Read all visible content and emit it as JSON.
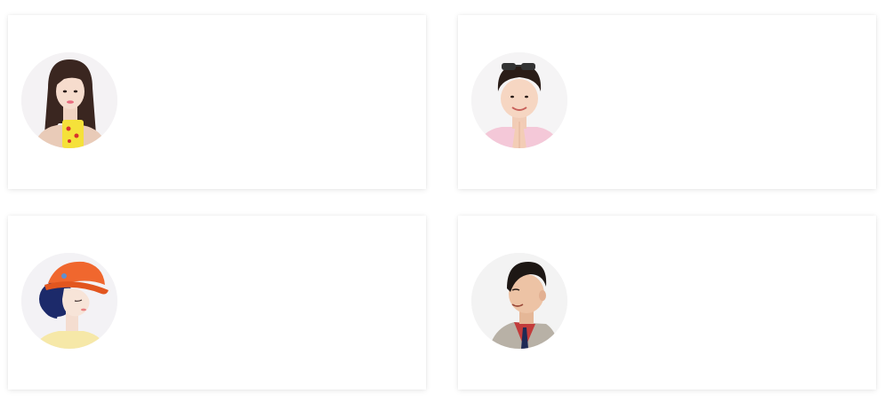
{
  "cards": [
    {
      "name": "",
      "description": ""
    },
    {
      "name": "",
      "description": ""
    },
    {
      "name": "",
      "description": ""
    },
    {
      "name": "",
      "description": ""
    }
  ],
  "colors": {
    "card_bg": "#ffffff",
    "avatar_bg": "#f3f2f4",
    "shadow": "rgba(0,0,0,0.10)"
  },
  "icons": [
    "avatar-woman-with-phone",
    "avatar-woman-with-glasses",
    "avatar-woman-with-orange-hat",
    "avatar-man-in-suit"
  ]
}
